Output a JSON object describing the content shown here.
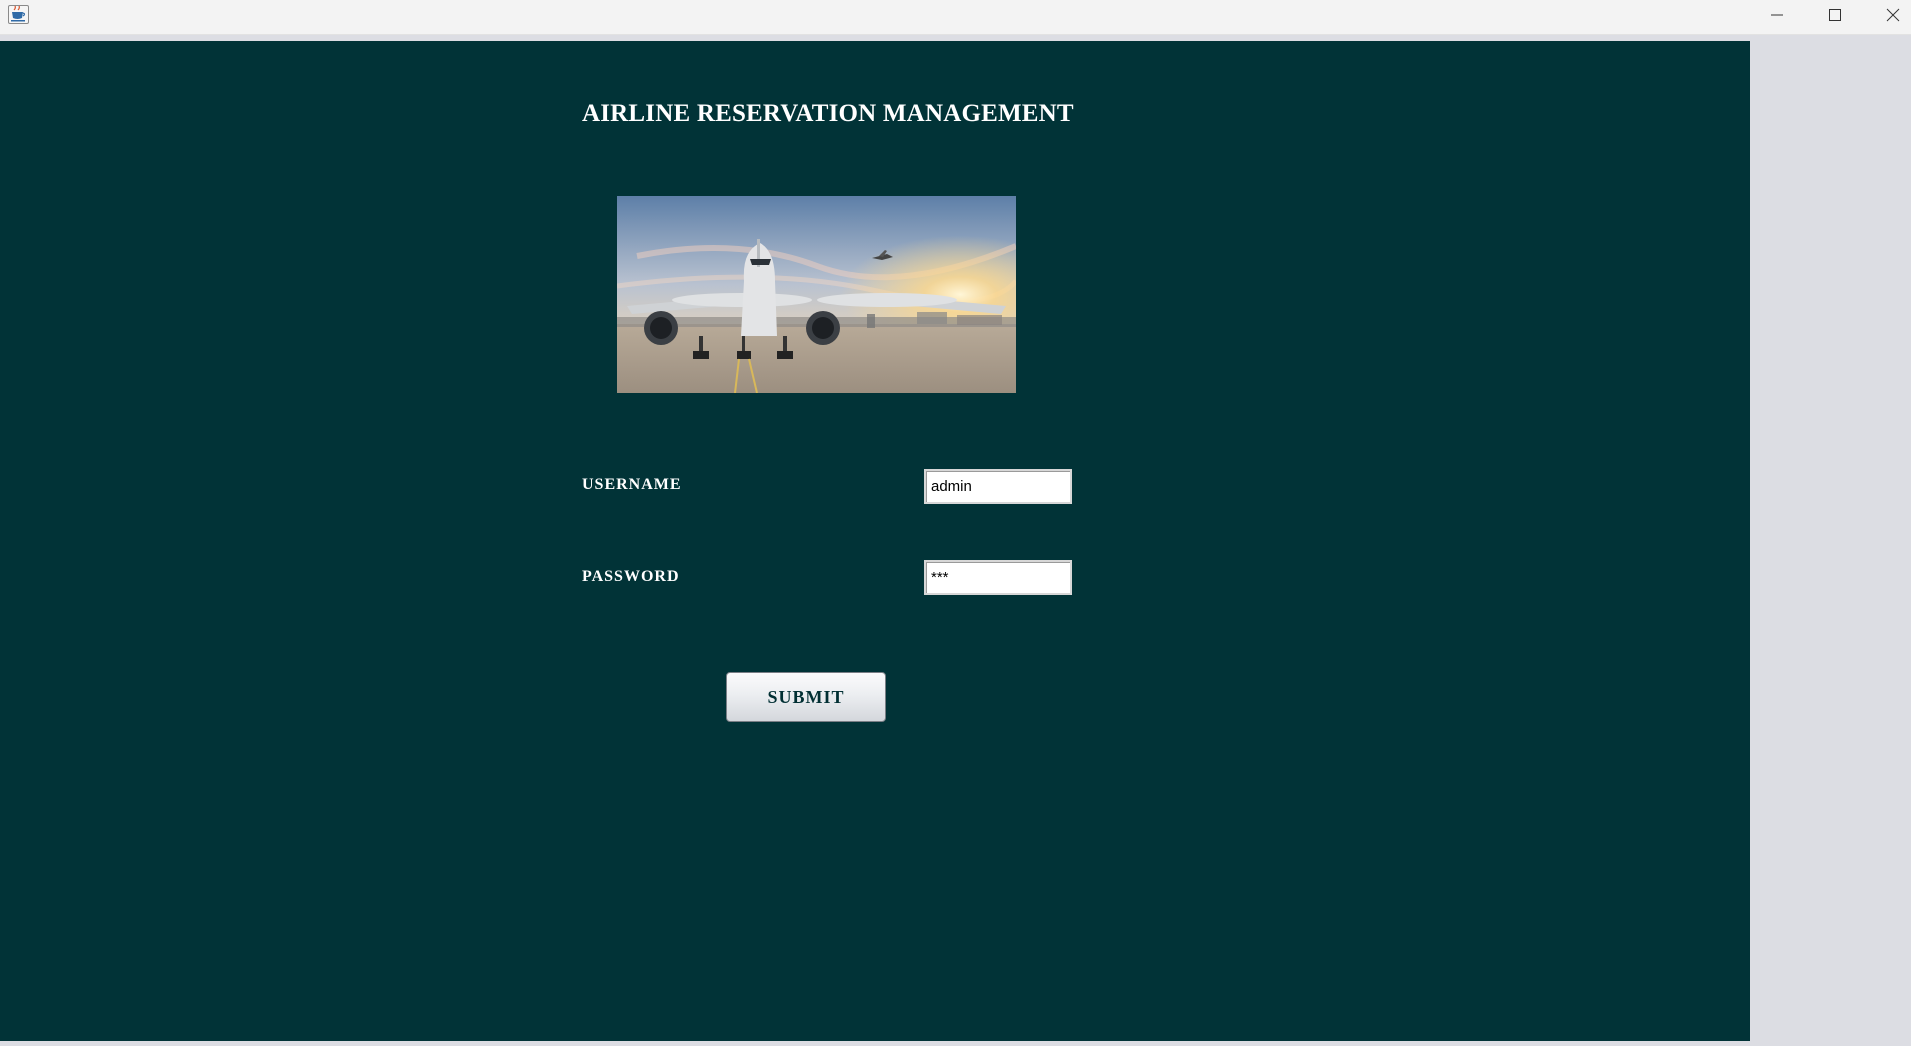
{
  "window": {
    "title": "",
    "controls": [
      "minimize",
      "maximize",
      "close"
    ]
  },
  "app": {
    "title": "AIRLINE RESERVATION MANAGEMENT"
  },
  "hero_image": {
    "alt": "airplane-on-runway"
  },
  "form": {
    "username_label": "USERNAME",
    "username_value": "admin",
    "password_label": "PASSWORD",
    "password_value": "***",
    "submit_label": "SUBMIT"
  },
  "colors": {
    "background": "#013337",
    "title_text": "#ffffff",
    "button_text": "#012f33"
  },
  "icons": {
    "app": "java-cup-icon",
    "minimize": "minimize-icon",
    "maximize": "maximize-icon",
    "close": "close-icon"
  }
}
